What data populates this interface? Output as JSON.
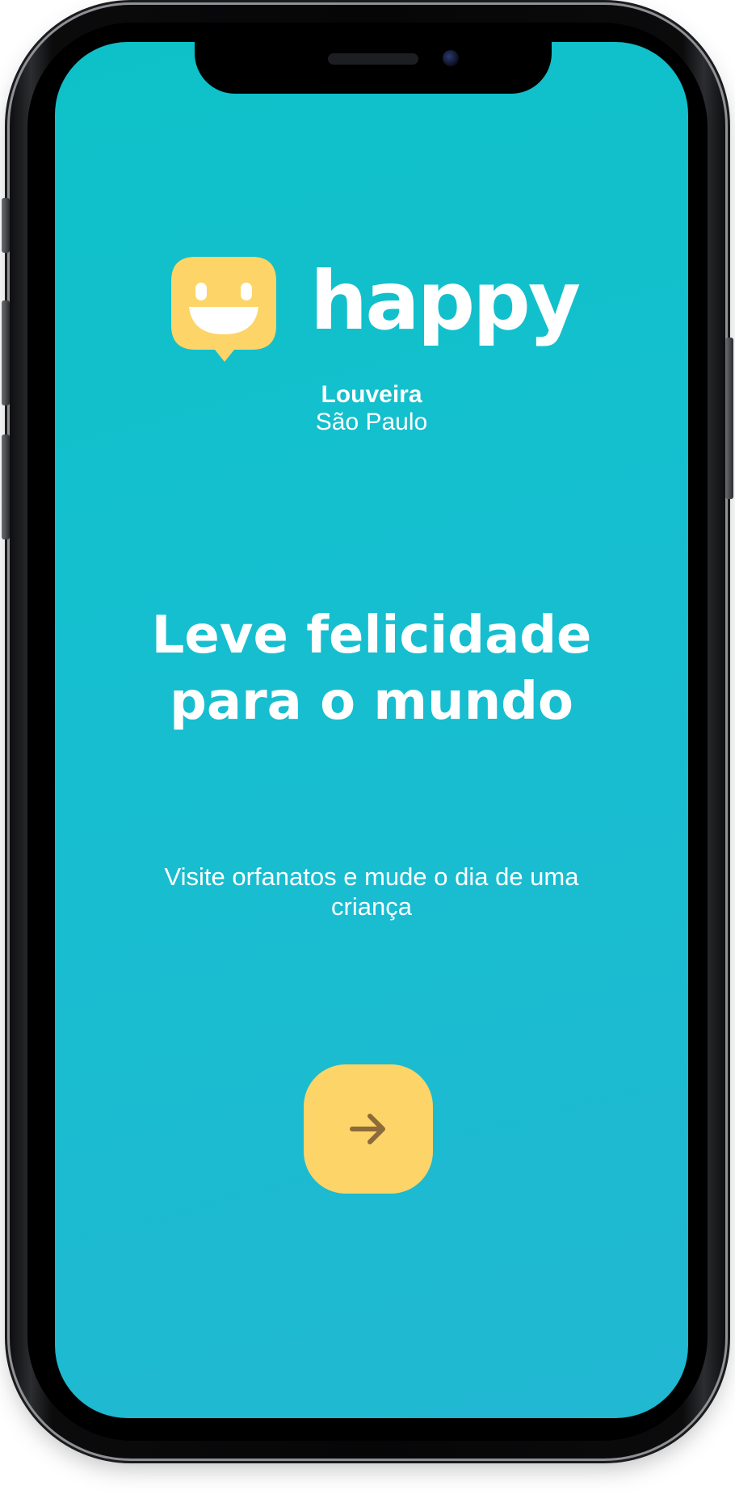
{
  "brand": {
    "name": "happy",
    "logo_icon": "smiley-speech-bubble-icon",
    "logo_color": "#fdd467"
  },
  "location": {
    "city": "Louveira",
    "state": "São Paulo"
  },
  "hero": {
    "title_line1": "Leve felicidade",
    "title_line2": "para o mundo",
    "subtitle_line1": "Visite orfanatos e mude o dia de uma",
    "subtitle_line2": "criança"
  },
  "cta": {
    "icon": "arrow-right-icon",
    "color": "#fdd467",
    "icon_color": "#8b6a3c"
  },
  "theme": {
    "background_start": "#0ec1c8",
    "background_end": "#21b8d2",
    "text_color": "#ffffff"
  }
}
